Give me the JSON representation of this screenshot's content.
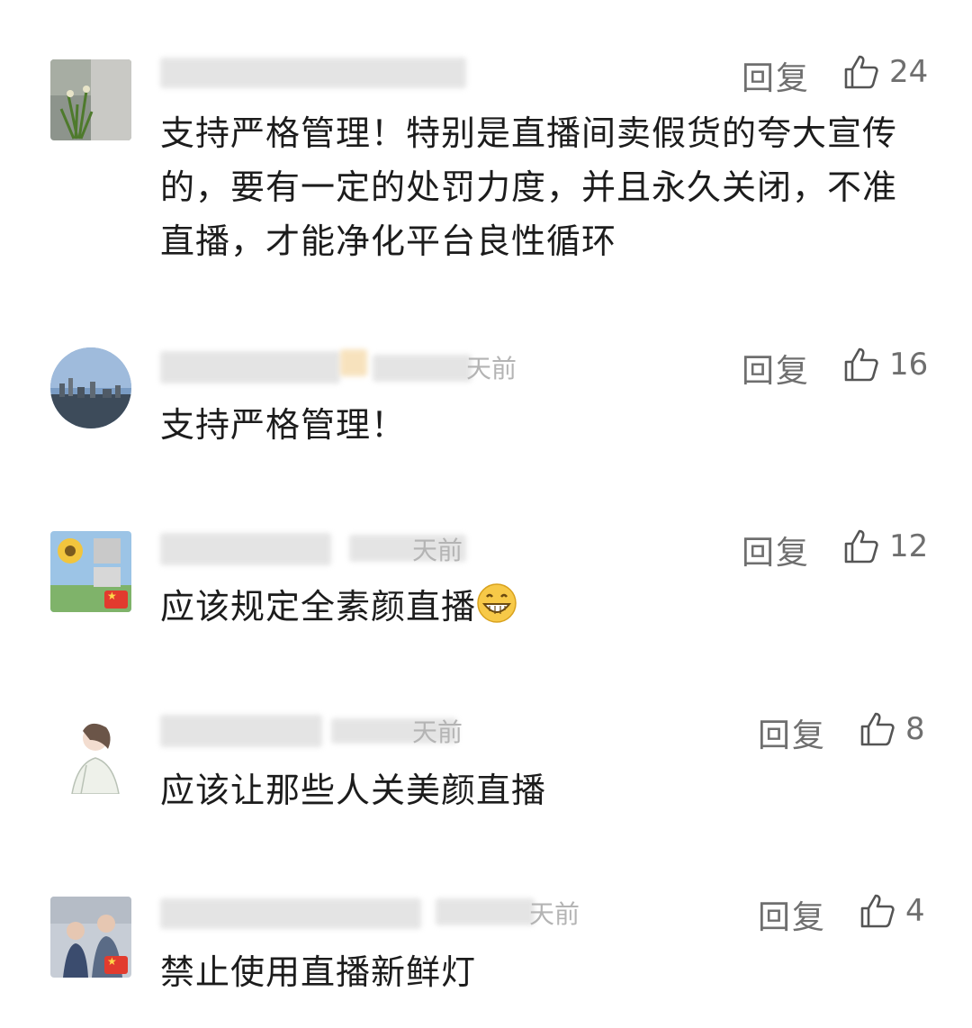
{
  "comments": [
    {
      "username": "",
      "time_suffix": "",
      "reply_label": "回复",
      "likes": "24",
      "text": "支持严格管理！特别是直播间卖假货的夸大宣传的，要有一定的处罚力度，并且永久关闭，不准直播，才能净化平台良性循环",
      "emoji": "",
      "avatar_icon": "plant-photo-avatar",
      "flag": false
    },
    {
      "username": "",
      "time_suffix": "天前",
      "reply_label": "回复",
      "likes": "16",
      "text": "支持严格管理！",
      "emoji": "",
      "avatar_icon": "city-skyline-avatar",
      "flag": false
    },
    {
      "username": "",
      "time_suffix": "天前",
      "reply_label": "回复",
      "likes": "12",
      "text": "应该规定全素颜直播",
      "emoji": "grinning-face-emoji",
      "avatar_icon": "sunflower-avatar",
      "flag": true
    },
    {
      "username": "",
      "time_suffix": "天前",
      "reply_label": "回复",
      "likes": "8",
      "text": "应该让那些人关美颜直播",
      "emoji": "",
      "avatar_icon": "girl-sketch-avatar",
      "flag": false
    },
    {
      "username": "",
      "time_suffix": "天前",
      "reply_label": "回复",
      "likes": "4",
      "text": "禁止使用直播新鲜灯",
      "emoji": "",
      "avatar_icon": "couple-photo-avatar",
      "flag": true
    }
  ],
  "colors": {
    "text": "#1c1c1c",
    "secondary": "#6f6f6f",
    "meta": "#b4b4b4",
    "flag": "#e23b2e"
  }
}
